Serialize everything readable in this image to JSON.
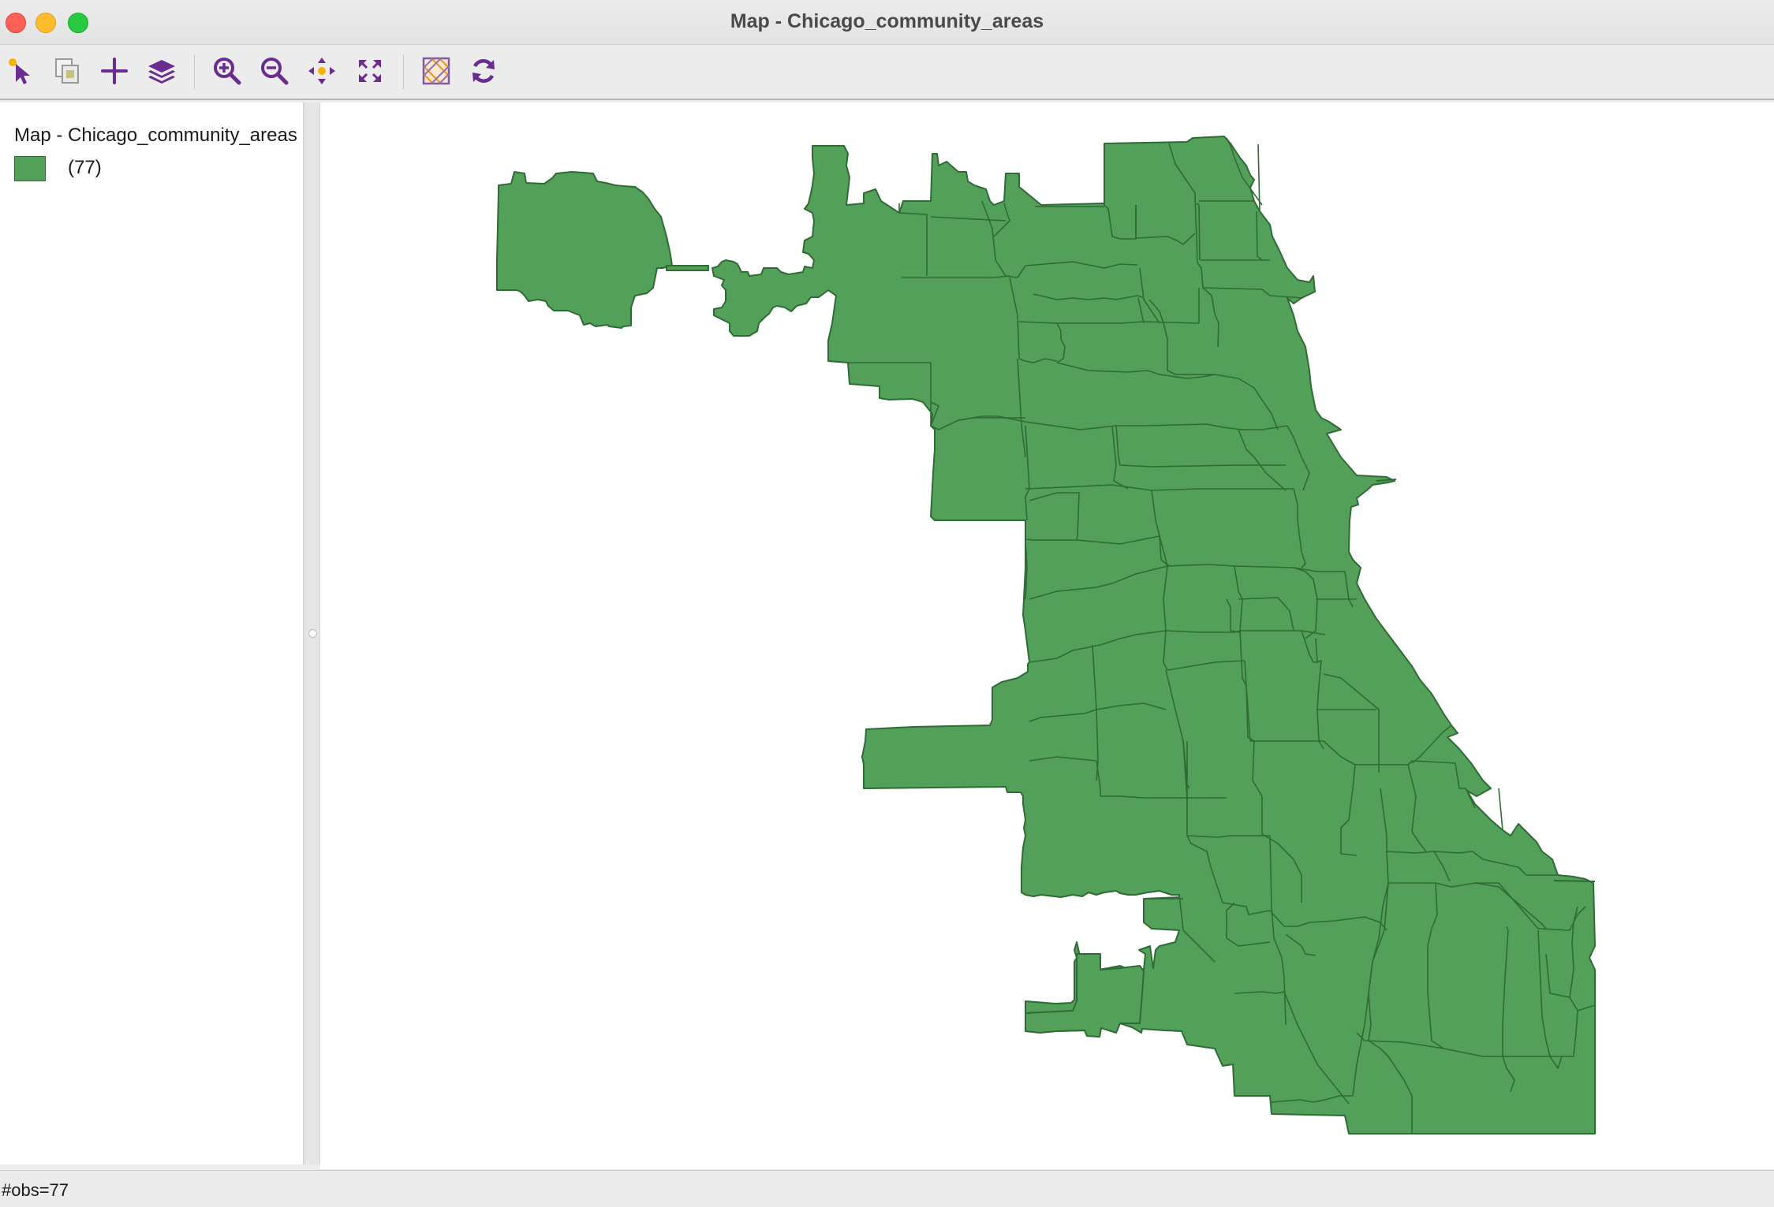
{
  "window": {
    "title": "Map - Chicago_community_areas"
  },
  "toolbar": {
    "buttons": [
      {
        "name": "select-tool-button",
        "icon": "pointer-arrow-icon"
      },
      {
        "name": "selection-shape-button",
        "icon": "selection-copy-icon"
      },
      {
        "name": "add-layer-button",
        "icon": "plus-icon"
      },
      {
        "name": "layers-button",
        "icon": "layers-stack-icon"
      },
      {
        "name": "zoom-in-button",
        "icon": "zoom-in-icon"
      },
      {
        "name": "zoom-out-button",
        "icon": "zoom-out-icon"
      },
      {
        "name": "pan-button",
        "icon": "pan-arrows-icon"
      },
      {
        "name": "full-extent-button",
        "icon": "expand-arrows-icon"
      },
      {
        "name": "basemap-button",
        "icon": "basemap-grid-icon"
      },
      {
        "name": "refresh-button",
        "icon": "refresh-icon"
      }
    ],
    "icon_color": "#6a2c91"
  },
  "legend": {
    "title": "Map - Chicago_community_areas",
    "entries": [
      {
        "label": "(77)",
        "color": "#53a05a"
      }
    ]
  },
  "map": {
    "fill_color": "#53a05a",
    "stroke_color": "#2f6b35"
  },
  "status": {
    "text": "#obs=77"
  }
}
